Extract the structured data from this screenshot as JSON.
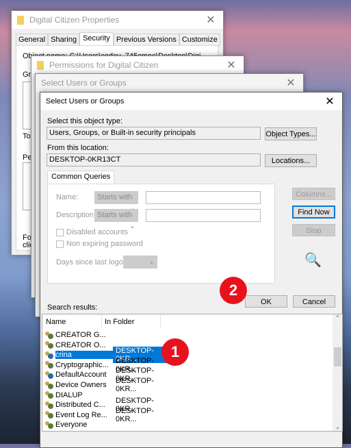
{
  "props": {
    "title": "Digital Citizen Properties",
    "tabs": [
      "General",
      "Sharing",
      "Security",
      "Previous Versions",
      "Customize"
    ],
    "active_tab": "Security",
    "object_name_partial": "Object name:    C:\\Users\\codey_745cmoe\\Desktop\\Digital Citizen",
    "frag_gr": "Gr",
    "frag_to": "To",
    "frag_pe": "Pe",
    "frag_for": "For",
    "frag_clic": "clic"
  },
  "permissions": {
    "title": "Permissions for Digital Citizen"
  },
  "select_bg": {
    "title": "Select Users or Groups"
  },
  "dialog": {
    "title": "Select Users or Groups",
    "object_type_label": "Select this object type:",
    "object_type_value": "Users, Groups, or Built-in security principals",
    "object_types_button": "Object Types...",
    "location_label": "From this location:",
    "location_value": "DESKTOP-0KR13CT",
    "locations_button": "Locations...",
    "queries_tab": "Common Queries",
    "name_label": "Name:",
    "description_label": "Description:",
    "starts_with": "Starts with",
    "disabled_accounts": "Disabled accounts",
    "non_expiring": "Non expiring password",
    "days_label": "Days since last logon:",
    "columns_button": "Columns...",
    "find_now_button": "Find Now",
    "stop_button": "Stop",
    "ok_button": "OK",
    "cancel_button": "Cancel",
    "results_label": "Search results:",
    "col_name": "Name",
    "col_folder": "In Folder",
    "results": [
      {
        "name": "CREATOR G...",
        "folder": ""
      },
      {
        "name": "CREATOR O...",
        "folder": ""
      },
      {
        "name": "crina",
        "folder": "DESKTOP-0KR...",
        "selected": true,
        "type": "user"
      },
      {
        "name": "Cryptographic...",
        "folder": "DESKTOP-0KR..."
      },
      {
        "name": "DefaultAccount",
        "folder": "DESKTOP-0KR...",
        "type": "user"
      },
      {
        "name": "Device Owners",
        "folder": "DESKTOP-0KR..."
      },
      {
        "name": "DIALUP",
        "folder": ""
      },
      {
        "name": "Distributed C...",
        "folder": "DESKTOP-0KR..."
      },
      {
        "name": "Event Log Re...",
        "folder": "DESKTOP-0KR..."
      },
      {
        "name": "Everyone",
        "folder": ""
      }
    ]
  },
  "badges": [
    "1",
    "2"
  ],
  "colors": {
    "selection": "#0078d7",
    "badge": "#e8121e"
  }
}
